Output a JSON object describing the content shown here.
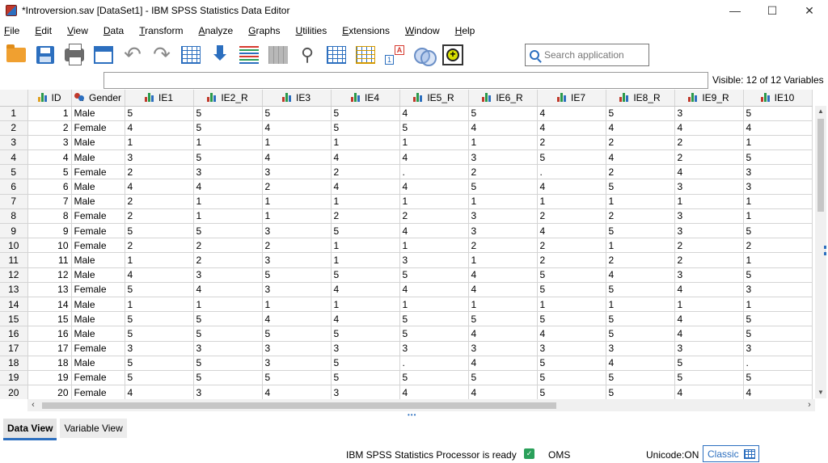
{
  "window": {
    "title": "*Introversion.sav [DataSet1] - IBM SPSS Statistics Data Editor",
    "minimize": "—",
    "maximize": "☐",
    "close": "✕"
  },
  "menu": [
    "File",
    "Edit",
    "View",
    "Data",
    "Transform",
    "Analyze",
    "Graphs",
    "Utilities",
    "Extensions",
    "Window",
    "Help"
  ],
  "toolbar": {
    "icons": [
      "open-folder-icon",
      "save-icon",
      "print-icon",
      "dialog-recall-icon",
      "undo-icon",
      "redo-icon",
      "goto-case-icon",
      "goto-variable-icon",
      "variables-icon",
      "run-descriptives-icon",
      "find-icon",
      "split-file-icon",
      "select-cases-icon",
      "value-labels-icon",
      "use-sets-icon",
      "extensions-hub-icon"
    ],
    "search_placeholder": "Search application"
  },
  "visible_label": "Visible: 12 of 12 Variables",
  "columns": [
    {
      "name": "ID",
      "type": "scale"
    },
    {
      "name": "Gender",
      "type": "nominal"
    },
    {
      "name": "IE1",
      "type": "ordinal"
    },
    {
      "name": "IE2_R",
      "type": "ordinal"
    },
    {
      "name": "IE3",
      "type": "ordinal"
    },
    {
      "name": "IE4",
      "type": "ordinal"
    },
    {
      "name": "IE5_R",
      "type": "ordinal"
    },
    {
      "name": "IE6_R",
      "type": "ordinal"
    },
    {
      "name": "IE7",
      "type": "ordinal"
    },
    {
      "name": "IE8_R",
      "type": "ordinal"
    },
    {
      "name": "IE9_R",
      "type": "ordinal"
    },
    {
      "name": "IE10",
      "type": "ordinal"
    }
  ],
  "rows": [
    [
      "1",
      "1",
      "Male",
      "5",
      "5",
      "5",
      "5",
      "4",
      "5",
      "4",
      "5",
      "3",
      "5"
    ],
    [
      "2",
      "2",
      "Female",
      "4",
      "5",
      "4",
      "5",
      "5",
      "4",
      "4",
      "4",
      "4",
      "4"
    ],
    [
      "3",
      "3",
      "Male",
      "1",
      "1",
      "1",
      "1",
      "1",
      "1",
      "2",
      "2",
      "2",
      "1"
    ],
    [
      "4",
      "4",
      "Male",
      "3",
      "5",
      "4",
      "4",
      "4",
      "3",
      "5",
      "4",
      "2",
      "5"
    ],
    [
      "5",
      "5",
      "Female",
      "2",
      "3",
      "3",
      "2",
      ".",
      "2",
      ".",
      "2",
      "4",
      "3"
    ],
    [
      "6",
      "6",
      "Male",
      "4",
      "4",
      "2",
      "4",
      "4",
      "5",
      "4",
      "5",
      "3",
      "3"
    ],
    [
      "7",
      "7",
      "Male",
      "2",
      "1",
      "1",
      "1",
      "1",
      "1",
      "1",
      "1",
      "1",
      "1"
    ],
    [
      "8",
      "8",
      "Female",
      "2",
      "1",
      "1",
      "2",
      "2",
      "3",
      "2",
      "2",
      "3",
      "1"
    ],
    [
      "9",
      "9",
      "Female",
      "5",
      "5",
      "3",
      "5",
      "4",
      "3",
      "4",
      "5",
      "3",
      "5"
    ],
    [
      "10",
      "10",
      "Female",
      "2",
      "2",
      "2",
      "1",
      "1",
      "2",
      "2",
      "1",
      "2",
      "2"
    ],
    [
      "11",
      "11",
      "Male",
      "1",
      "2",
      "3",
      "1",
      "3",
      "1",
      "2",
      "2",
      "2",
      "1"
    ],
    [
      "12",
      "12",
      "Male",
      "4",
      "3",
      "5",
      "5",
      "5",
      "4",
      "5",
      "4",
      "3",
      "5"
    ],
    [
      "13",
      "13",
      "Female",
      "5",
      "4",
      "3",
      "4",
      "4",
      "4",
      "5",
      "5",
      "4",
      "3"
    ],
    [
      "14",
      "14",
      "Male",
      "1",
      "1",
      "1",
      "1",
      "1",
      "1",
      "1",
      "1",
      "1",
      "1"
    ],
    [
      "15",
      "15",
      "Male",
      "5",
      "5",
      "4",
      "4",
      "5",
      "5",
      "5",
      "5",
      "4",
      "5"
    ],
    [
      "16",
      "16",
      "Male",
      "5",
      "5",
      "5",
      "5",
      "5",
      "4",
      "4",
      "5",
      "4",
      "5"
    ],
    [
      "17",
      "17",
      "Female",
      "3",
      "3",
      "3",
      "3",
      "3",
      "3",
      "3",
      "3",
      "3",
      "3"
    ],
    [
      "18",
      "18",
      "Male",
      "5",
      "5",
      "3",
      "5",
      ".",
      "4",
      "5",
      "4",
      "5",
      "."
    ],
    [
      "19",
      "19",
      "Female",
      "5",
      "5",
      "5",
      "5",
      "5",
      "5",
      "5",
      "5",
      "5",
      "5"
    ],
    [
      "20",
      "20",
      "Female",
      "4",
      "3",
      "4",
      "3",
      "4",
      "4",
      "5",
      "5",
      "4",
      "4"
    ]
  ],
  "tabs": {
    "data_view": "Data View",
    "variable_view": "Variable View"
  },
  "status": {
    "processor": "IBM SPSS Statistics Processor is ready",
    "oms": "OMS",
    "unicode": "Unicode:ON",
    "classic": "Classic"
  },
  "colors": {
    "accent": "#2c6fbf",
    "header_bg": "#f3f3f3",
    "grid_line": "#d4d4d4"
  }
}
